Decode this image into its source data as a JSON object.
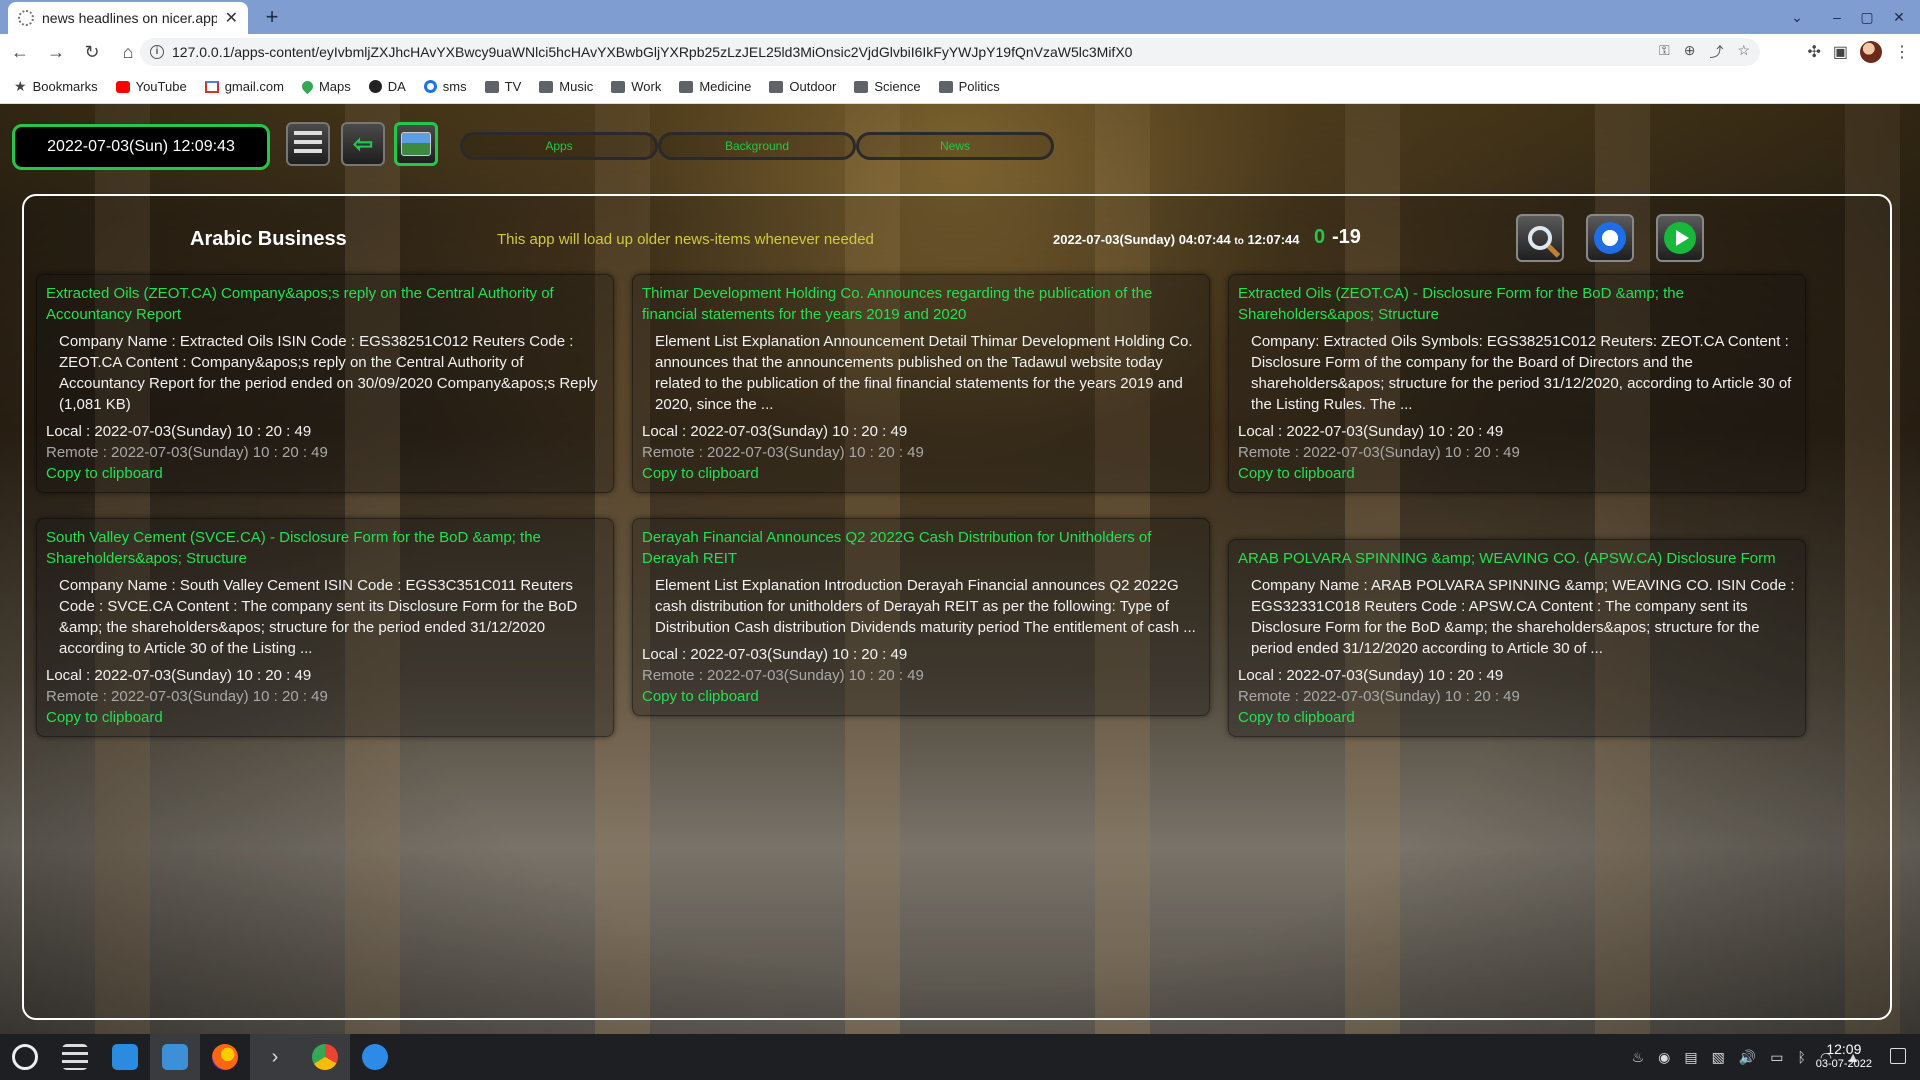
{
  "browser": {
    "tab_title": "news headlines on nicer.app",
    "url": "127.0.0.1/apps-content/eyIvbmljZXJhcHAvYXBwcy9uaWNlci5hcHAvYXBwbGljYXRpb25zLzJEL25ld3MiOnsic2VjdGlvbiI6IkFyYWJpY19fQnVzaW5lc3MifX0",
    "bookmarks": [
      "Bookmarks",
      "YouTube",
      "gmail.com",
      "Maps",
      "DA",
      "sms",
      "TV",
      "Music",
      "Work",
      "Medicine",
      "Outdoor",
      "Science",
      "Politics"
    ]
  },
  "app": {
    "clock": "2022-07-03(Sun) 12:09:43",
    "pills": [
      "Apps",
      "Background",
      "News"
    ],
    "title": "Arabic Business",
    "notice": "This app will load up older news-items whenever needed",
    "range_from": "2022-07-03(Sunday) 04:07:44",
    "range_to_word": "to",
    "range_to": "12:07:44",
    "count_a": "0",
    "count_b": "-19"
  },
  "cards": [
    {
      "title": "Extracted Oils (ZEOT.CA) Company&apos;s reply on the Central Authority of Accountancy Report",
      "body": "Company Name : Extracted Oils ISIN Code : EGS38251C012 Reuters Code : ZEOT.CA Content : Company&apos;s reply on the Central Authority of Accountancy Report for the period ended on 30/09/2020 Company&apos;s Reply (1,081 KB)",
      "local": "Local : 2022-07-03(Sunday) 10 : 20 : 49",
      "remote": "Remote : 2022-07-03(Sunday) 10 : 20 : 49",
      "copy": "Copy to clipboard"
    },
    {
      "title": "Thimar Development Holding Co. Announces regarding the publication of the financial statements for the years 2019 and 2020",
      "body": "Element List Explanation Announcement Detail Thimar Development Holding Co. announces that the announcements published on the Tadawul website today related to the publication of the final financial statements for the years 2019 and 2020, since the ...",
      "local": "Local : 2022-07-03(Sunday) 10 : 20 : 49",
      "remote": "Remote : 2022-07-03(Sunday) 10 : 20 : 49",
      "copy": "Copy to clipboard"
    },
    {
      "title": "Extracted Oils (ZEOT.CA) - Disclosure Form for the BoD &amp; the Shareholders&apos; Structure",
      "body": "Company: Extracted Oils Symbols: EGS38251C012 Reuters: ZEOT.CA Content : Disclosure Form of the company for the Board of Directors and the shareholders&apos; structure for the period 31/12/2020, according to Article 30 of the Listing Rules. The ...",
      "local": "Local : 2022-07-03(Sunday) 10 : 20 : 49",
      "remote": "Remote : 2022-07-03(Sunday) 10 : 20 : 49",
      "copy": "Copy to clipboard"
    },
    {
      "title": "South Valley Cement (SVCE.CA) - Disclosure Form for the BoD &amp; the Shareholders&apos; Structure",
      "body": "Company Name : South Valley Cement ISIN Code : EGS3C351C011 Reuters Code : SVCE.CA Content : The company sent its Disclosure Form for the BoD &amp; the shareholders&apos; structure for the period ended 31/12/2020 according to Article 30 of the Listing ...",
      "local": "Local : 2022-07-03(Sunday) 10 : 20 : 49",
      "remote": "Remote : 2022-07-03(Sunday) 10 : 20 : 49",
      "copy": "Copy to clipboard"
    },
    {
      "title": "Derayah Financial Announces Q2 2022G Cash Distribution for Unitholders of Derayah REIT",
      "body": "Element List Explanation Introduction Derayah Financial announces Q2 2022G cash distribution for unitholders of Derayah REIT as per the following: Type of Distribution Cash distribution Dividends maturity period The entitlement of cash ...",
      "local": "Local : 2022-07-03(Sunday) 10 : 20 : 49",
      "remote": "Remote : 2022-07-03(Sunday) 10 : 20 : 49",
      "copy": "Copy to clipboard"
    },
    {
      "title": "ARAB POLVARA SPINNING &amp; WEAVING CO. (APSW.CA) Disclosure Form",
      "body": "Company Name : ARAB POLVARA SPINNING &amp; WEAVING CO. ISIN Code : EGS32331C018 Reuters Code : APSW.CA Content : The company sent its Disclosure Form for the BoD &amp; the shareholders&apos; structure for the period ended 31/12/2020 according to Article 30 of ...",
      "local": "Local : 2022-07-03(Sunday) 10 : 20 : 49",
      "remote": "Remote : 2022-07-03(Sunday) 10 : 20 : 49",
      "copy": "Copy to clipboard"
    }
  ],
  "taskbar": {
    "time": "12:09",
    "date": "03-07-2022"
  },
  "colors": {
    "accent_green": "#22e050",
    "notice_yellow": "#d2cb36"
  }
}
